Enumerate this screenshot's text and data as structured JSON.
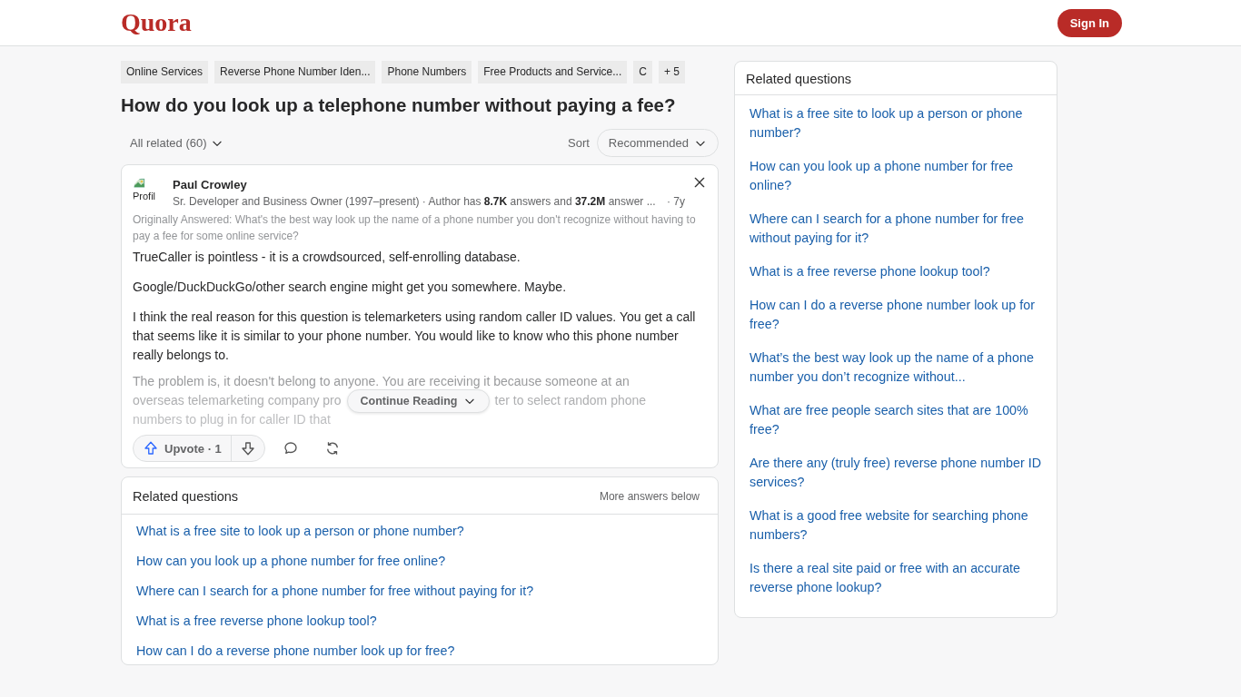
{
  "header": {
    "logo": "Quora",
    "sign_in": "Sign In"
  },
  "topics": [
    {
      "label": "Online Services"
    },
    {
      "label": "Reverse Phone Number Iden..."
    },
    {
      "label": "Phone Numbers"
    },
    {
      "label": "Free Products and Service..."
    },
    {
      "label": "C"
    },
    {
      "label": "+ 5"
    }
  ],
  "question": "How do you look up a telephone number without paying a fee?",
  "filter": {
    "label": "All related (60)",
    "sort_label": "Sort",
    "sort_value": "Recommended"
  },
  "answer": {
    "avatar_alt": "Profil",
    "author": "Paul Crowley",
    "credential": "Sr. Developer and Business Owner (1997–present) · Author has **8.7K** answers and **37.2M** answer ...",
    "age": "· 7y",
    "originally_answered": "Originally Answered: What's the best way look up the name of a phone number you don't recognize without having to pay a fee for some online service?",
    "paragraphs": [
      "TrueCaller is pointless - it is a crowdsourced, self-enrolling database.",
      "Google/DuckDuckGo/other search engine might get you somewhere. Maybe.",
      "I think the real reason for this question is telemarketers using random caller ID values. You get a call that seems like it is similar to your phone number. You would like to know who this phone number really belongs to."
    ],
    "faded_lines": [
      [
        "The problem is, it doesn't belong to anyone. You are receiving it because someone at an"
      ],
      [
        "overseas telemarketing company pro",
        "ter to select random phone"
      ],
      [
        "numbers to plug in for caller ID that"
      ]
    ],
    "continue_reading": "Continue Reading",
    "upvote": "Upvote · 1"
  },
  "related_inline": {
    "title": "Related questions",
    "note": "More answers below",
    "items": [
      "What is a free site to look up a person or phone number?",
      "How can you look up a phone number for free online?",
      "Where can I search for a phone number for free without paying for it?",
      "What is a free reverse phone lookup tool?",
      "How can I do a reverse phone number look up for free?"
    ]
  },
  "related_sidebar": {
    "title": "Related questions",
    "items": [
      "What is a free site to look up a person or phone number?",
      "How can you look up a phone number for free online?",
      "Where can I search for a phone number for free without paying for it?",
      "What is a free reverse phone lookup tool?",
      "How can I do a reverse phone number look up for free?",
      "What’s the best way look up the name of a phone number you don’t recognize without...",
      "What are free people search sites that are 100% free?",
      "Are there any (truly free) reverse phone number ID services?",
      "What is a good free website for searching phone numbers?",
      "Is there a real site paid or free with an accurate reverse phone lookup?"
    ]
  }
}
